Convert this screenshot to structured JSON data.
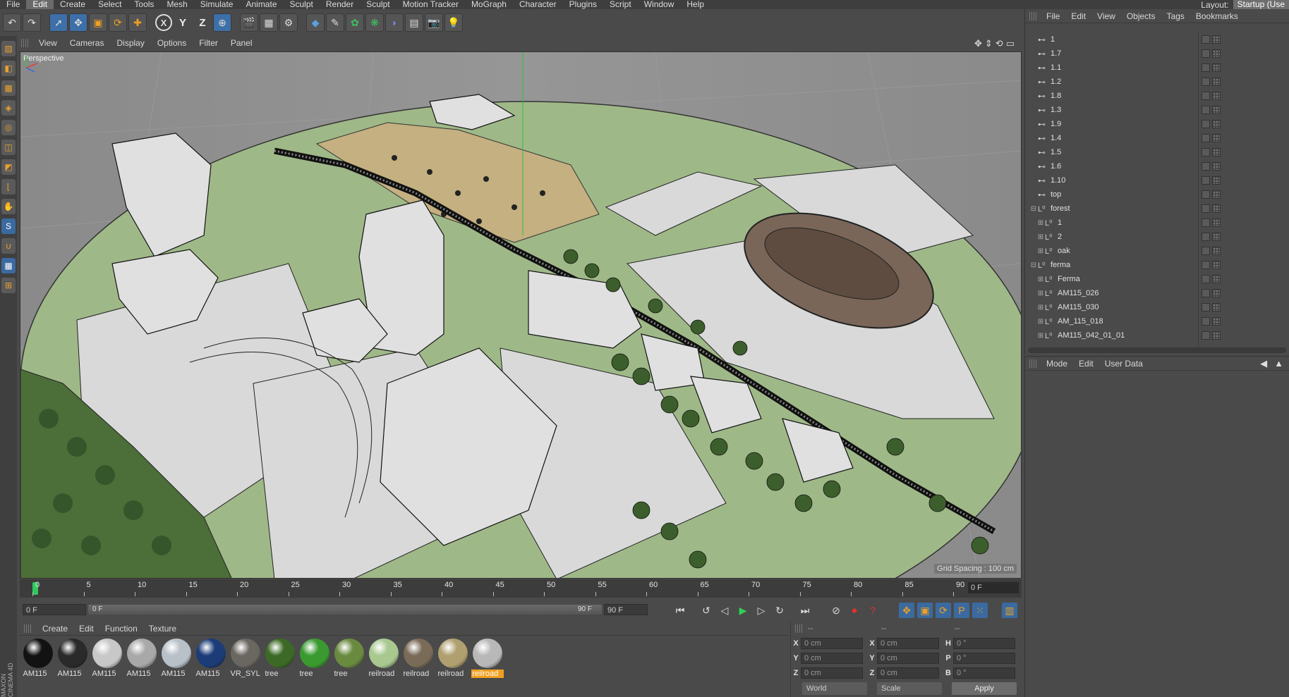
{
  "menubar": {
    "items": [
      "File",
      "Edit",
      "Create",
      "Select",
      "Tools",
      "Mesh",
      "Simulate",
      "Animate",
      "Sculpt",
      "Render",
      "Sculpt",
      "Motion Tracker",
      "MoGraph",
      "Character",
      "Plugins",
      "Script",
      "Window",
      "Help"
    ],
    "active_index": 1,
    "layout_label": "Layout:",
    "layout_value": "Startup (Use"
  },
  "toolbar": {
    "x_label": "X",
    "y_label": "Y",
    "z_label": "Z"
  },
  "view_menu": [
    "View",
    "Cameras",
    "Display",
    "Options",
    "Filter",
    "Panel"
  ],
  "viewport": {
    "label": "Perspective",
    "grid_spacing": "Grid Spacing : 100 cm"
  },
  "timeline": {
    "ticks": [
      "0",
      "5",
      "10",
      "15",
      "20",
      "25",
      "30",
      "35",
      "40",
      "45",
      "50",
      "55",
      "60",
      "65",
      "70",
      "75",
      "80",
      "85",
      "90"
    ],
    "current_frame": "0 F"
  },
  "controls": {
    "start_frame": "0 F",
    "range_start": "0 F",
    "range_end": "90 F",
    "end_frame": "90 F"
  },
  "material_manager": {
    "menu": [
      "Create",
      "Edit",
      "Function",
      "Texture"
    ],
    "materials": [
      {
        "name": "AM115",
        "color": "#121212"
      },
      {
        "name": "AM115",
        "color": "#2a2a2a"
      },
      {
        "name": "AM115",
        "color": "#c8c8c8"
      },
      {
        "name": "AM115",
        "color": "#a8a8a8"
      },
      {
        "name": "AM115",
        "color": "#b8c0c8"
      },
      {
        "name": "AM115",
        "color": "#1c3c78"
      },
      {
        "name": "VR_SYL",
        "color": "#6a6660"
      },
      {
        "name": "tree",
        "color": "#3c6a26"
      },
      {
        "name": "tree",
        "color": "#3a9a30"
      },
      {
        "name": "tree",
        "color": "#6a8a40"
      },
      {
        "name": "reilroad",
        "color": "#a8c890"
      },
      {
        "name": "reilroad",
        "color": "#7a6a58"
      },
      {
        "name": "reilroad",
        "color": "#b0a070"
      },
      {
        "name": "reilroad",
        "color": "#b8b8b8"
      }
    ],
    "selected_index": 13
  },
  "coordinates": {
    "headers": [
      "--",
      "--",
      "--"
    ],
    "rows": [
      {
        "a": "X",
        "av": "0 cm",
        "b": "X",
        "bv": "0 cm",
        "c": "H",
        "cv": "0 °"
      },
      {
        "a": "Y",
        "av": "0 cm",
        "b": "Y",
        "bv": "0 cm",
        "c": "P",
        "cv": "0 °"
      },
      {
        "a": "Z",
        "av": "0 cm",
        "b": "Z",
        "bv": "0 cm",
        "c": "B",
        "cv": "0 °"
      }
    ],
    "mode_world": "World",
    "mode_scale": "Scale",
    "apply": "Apply"
  },
  "object_manager": {
    "menu": [
      "File",
      "Edit",
      "View",
      "Objects",
      "Tags",
      "Bookmarks"
    ],
    "objects": [
      {
        "name": "1",
        "indent": 0,
        "icon": "camera-icon",
        "expand": ""
      },
      {
        "name": "1.7",
        "indent": 0,
        "icon": "camera-icon",
        "expand": ""
      },
      {
        "name": "1.1",
        "indent": 0,
        "icon": "camera-icon",
        "expand": ""
      },
      {
        "name": "1.2",
        "indent": 0,
        "icon": "camera-icon",
        "expand": ""
      },
      {
        "name": "1.8",
        "indent": 0,
        "icon": "camera-icon",
        "expand": ""
      },
      {
        "name": "1.3",
        "indent": 0,
        "icon": "camera-icon",
        "expand": ""
      },
      {
        "name": "1.9",
        "indent": 0,
        "icon": "camera-icon",
        "expand": ""
      },
      {
        "name": "1.4",
        "indent": 0,
        "icon": "camera-icon",
        "expand": ""
      },
      {
        "name": "1.5",
        "indent": 0,
        "icon": "camera-icon",
        "expand": ""
      },
      {
        "name": "1.6",
        "indent": 0,
        "icon": "camera-icon",
        "expand": ""
      },
      {
        "name": "1.10",
        "indent": 0,
        "icon": "camera-icon",
        "expand": ""
      },
      {
        "name": "top",
        "indent": 0,
        "icon": "camera-icon",
        "expand": ""
      },
      {
        "name": "forest",
        "indent": 0,
        "icon": "null-icon",
        "expand": "-"
      },
      {
        "name": "1",
        "indent": 1,
        "icon": "null-icon",
        "expand": "+"
      },
      {
        "name": "2",
        "indent": 1,
        "icon": "null-icon",
        "expand": "+"
      },
      {
        "name": "oak",
        "indent": 1,
        "icon": "null-icon",
        "expand": "+"
      },
      {
        "name": "ferma",
        "indent": 0,
        "icon": "null-icon",
        "expand": "-"
      },
      {
        "name": "Ferma",
        "indent": 1,
        "icon": "null-icon",
        "expand": "+"
      },
      {
        "name": "AM115_026",
        "indent": 1,
        "icon": "null-icon",
        "expand": "+"
      },
      {
        "name": "AM115_030",
        "indent": 1,
        "icon": "null-icon",
        "expand": "+"
      },
      {
        "name": "AM_115_018",
        "indent": 1,
        "icon": "null-icon",
        "expand": "+"
      },
      {
        "name": "AM115_042_01_01",
        "indent": 1,
        "icon": "null-icon",
        "expand": "+"
      }
    ]
  },
  "attribute_manager": {
    "menu": [
      "Mode",
      "Edit",
      "User Data"
    ]
  },
  "brand": "MAXON CINEMA 4D"
}
